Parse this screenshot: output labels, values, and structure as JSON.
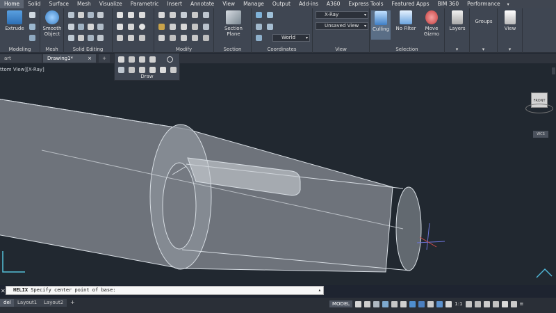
{
  "ribbon": {
    "tabs": [
      "Home",
      "Solid",
      "Surface",
      "Mesh",
      "Visualize",
      "Parametric",
      "Insert",
      "Annotate",
      "View",
      "Manage",
      "Output",
      "Add-ins",
      "A360",
      "Express Tools",
      "Featured Apps",
      "BIM 360",
      "Performance"
    ],
    "active_tab": "Home",
    "panels": {
      "modeling": {
        "label": "Modeling",
        "extrude": "Extrude"
      },
      "mesh": {
        "label": "Mesh",
        "smooth_object": "Smooth\nObject"
      },
      "solid_editing": {
        "label": "Solid Editing"
      },
      "modify": {
        "label": "Modify"
      },
      "section": {
        "label": "Section",
        "section_plane": "Section\nPlane"
      },
      "coordinates": {
        "label": "Coordinates",
        "ucs": "World"
      },
      "view": {
        "label": "View",
        "visual_style": "X-Ray",
        "named_view": "Unsaved View"
      },
      "selection": {
        "label": "Selection",
        "culling": "Culling",
        "no_filter": "No Filter",
        "move_gizmo": "Move\nGizmo"
      },
      "layers": {
        "label": "Layers"
      },
      "groups": {
        "label": "Groups"
      },
      "view_panel": {
        "label": "View"
      },
      "draw": {
        "label": "Draw"
      }
    }
  },
  "file_tabs": [
    "art",
    "Drawing1*"
  ],
  "viewport": {
    "label": "ttom View][X-Ray]",
    "viewcube_face": "FRONT",
    "wcs": "WCS"
  },
  "command_line": {
    "command": "HELIX",
    "prompt": "Specify center point of base:"
  },
  "layout_tabs": [
    "del",
    "Layout1",
    "Layout2"
  ],
  "status": {
    "model": "MODEL",
    "scale": "1:1"
  }
}
